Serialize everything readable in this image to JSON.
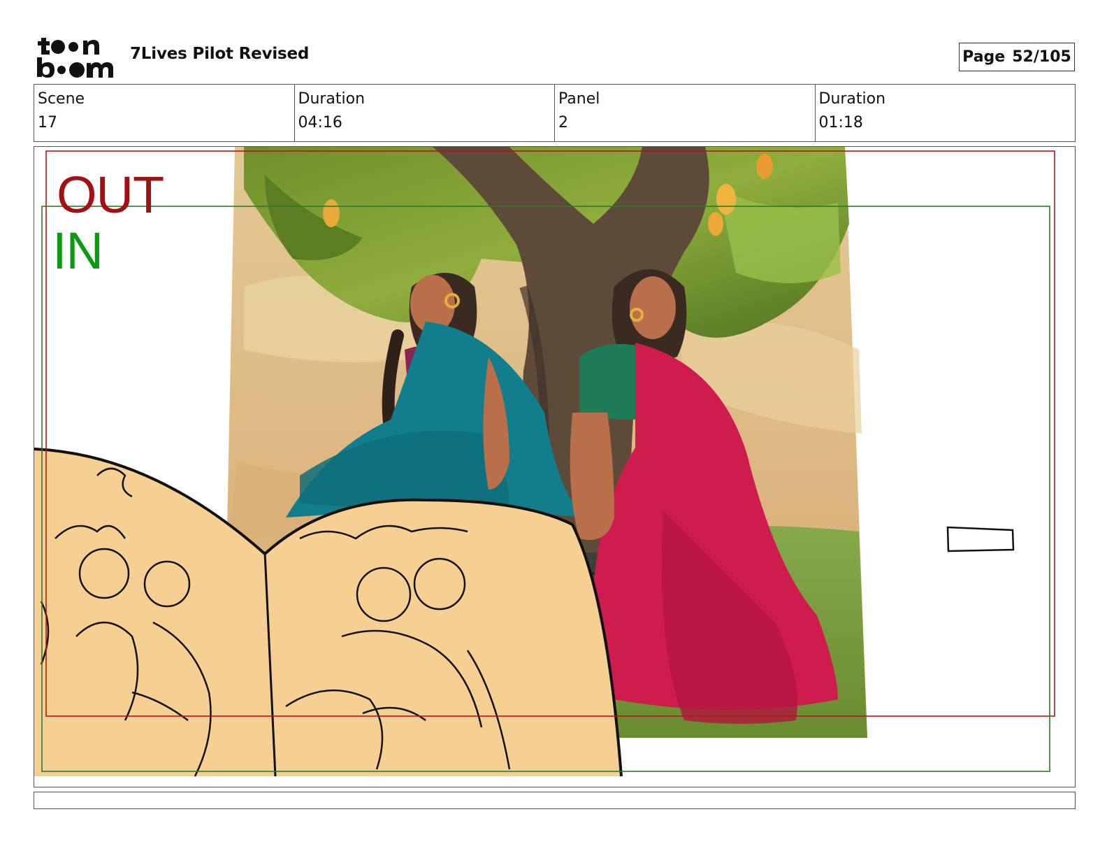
{
  "header": {
    "logo_name": "toon boom",
    "project_title": "7Lives Pilot Revised",
    "page_label": "Page",
    "page_number": "52/105"
  },
  "info": [
    {
      "label": "Scene",
      "value": "17"
    },
    {
      "label": "Duration",
      "value": "04:16"
    },
    {
      "label": "Panel",
      "value": "2"
    },
    {
      "label": "Duration",
      "value": "01:18"
    }
  ],
  "panel": {
    "out_label": "OUT",
    "in_label": "IN",
    "out_frame_color": "#b2161b",
    "in_frame_color": "#2a7d2a"
  },
  "caption": ""
}
